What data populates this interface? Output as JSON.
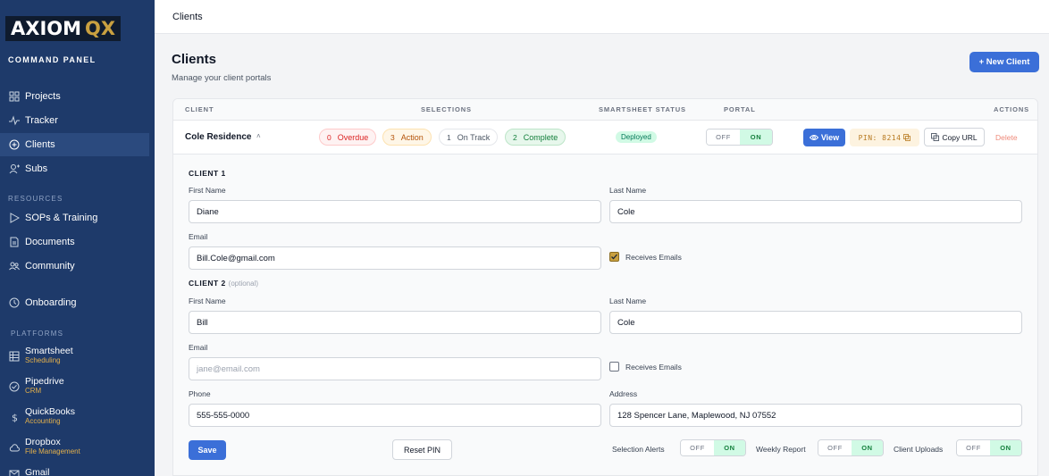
{
  "brand": {
    "name_part1": "AXIOM",
    "name_part2": "QX",
    "subtitle": "COMMAND PANEL",
    "accent": "#c9a040"
  },
  "sidebar": {
    "nav": [
      {
        "label": "Projects",
        "icon": "grid-icon"
      },
      {
        "label": "Tracker",
        "icon": "activity-icon"
      },
      {
        "label": "Clients",
        "icon": "plus-circle-icon",
        "active": true
      },
      {
        "label": "Subs",
        "icon": "user-plus-icon"
      }
    ],
    "resources_label": "RESOURCES",
    "resources": [
      {
        "label": "SOPs & Training",
        "icon": "play-icon"
      },
      {
        "label": "Documents",
        "icon": "document-icon"
      },
      {
        "label": "Community",
        "icon": "users-icon"
      }
    ],
    "onboarding": {
      "label": "Onboarding",
      "icon": "clock-icon"
    },
    "platforms_label": "PLATFORMS",
    "platforms": [
      {
        "name": "Smartsheet",
        "sub": "Scheduling",
        "icon": "table-icon"
      },
      {
        "name": "Pipedrive",
        "sub": "CRM",
        "icon": "check-circle-icon"
      },
      {
        "name": "QuickBooks",
        "sub": "Accounting",
        "icon": "dollar-icon"
      },
      {
        "name": "Dropbox",
        "sub": "File Management",
        "icon": "cloud-icon"
      },
      {
        "name": "Gmail",
        "sub": "",
        "icon": "mail-icon"
      }
    ]
  },
  "topbar": {
    "breadcrumb": "Clients"
  },
  "page": {
    "title": "Clients",
    "subtitle": "Manage your client portals",
    "new_button": "+ New Client"
  },
  "table": {
    "headers": {
      "client": "CLIENT",
      "selections": "SELECTIONS",
      "smartsheet": "SMARTSHEET STATUS",
      "portal": "PORTAL",
      "actions": "ACTIONS"
    },
    "row": {
      "name": "Cole Residence",
      "chevron": "˄",
      "selections": [
        {
          "count": "0",
          "label": "Overdue",
          "color": "#dc2626"
        },
        {
          "count": "3",
          "label": "Action",
          "color": "#b45309"
        },
        {
          "count": "1",
          "label": "On Track",
          "color": "#4b5563"
        },
        {
          "count": "2",
          "label": "Complete",
          "color": "#15803d"
        }
      ],
      "status": "Deployed",
      "portal": {
        "off": "OFF",
        "on": "ON"
      },
      "view": "View",
      "pin": "PIN: 8214",
      "copy_url": "Copy URL",
      "delete": "Delete"
    }
  },
  "form": {
    "client1": {
      "heading": "CLIENT 1",
      "first_name_label": "First Name",
      "first_name": "Diane",
      "last_name_label": "Last Name",
      "last_name": "Cole",
      "email_label": "Email",
      "email": "Bill.Cole@gmail.com",
      "receives_emails": "Receives Emails",
      "receives_emails_checked": true
    },
    "client2": {
      "heading": "CLIENT 2",
      "optional": "(optional)",
      "first_name_label": "First Name",
      "first_name": "Bill",
      "last_name_label": "Last Name",
      "last_name": "Cole",
      "email_label": "Email",
      "email_placeholder": "jane@email.com",
      "receives_emails": "Receives Emails",
      "receives_emails_checked": false
    },
    "phone_label": "Phone",
    "phone": "555-555-0000",
    "address_label": "Address",
    "address": "128 Spencer Lane, Maplewood, NJ 07552",
    "save": "Save",
    "reset_pin": "Reset PIN",
    "switches": [
      {
        "label": "Selection Alerts",
        "off": "OFF",
        "on": "ON"
      },
      {
        "label": "Weekly Report",
        "off": "OFF",
        "on": "ON"
      },
      {
        "label": "Client Uploads",
        "off": "OFF",
        "on": "ON"
      }
    ]
  }
}
